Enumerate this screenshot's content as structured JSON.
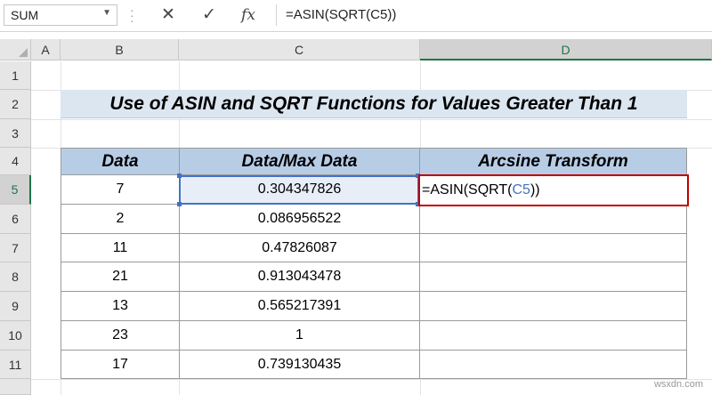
{
  "formula_bar": {
    "name_box": "SUM",
    "cancel_icon": "✕",
    "enter_icon": "✓",
    "fx_label": "fx",
    "formula": "=ASIN(SQRT(C5))"
  },
  "columns": [
    "A",
    "B",
    "C",
    "D"
  ],
  "rows": [
    "1",
    "2",
    "3",
    "4",
    "5",
    "6",
    "7",
    "8",
    "9",
    "10",
    "11"
  ],
  "title": "Use of ASIN and SQRT Functions for Values Greater Than 1",
  "table": {
    "headers": [
      "Data",
      "Data/Max Data",
      "Arcsine Transform"
    ],
    "data": [
      [
        "7",
        "0.304347826"
      ],
      [
        "2",
        "0.086956522"
      ],
      [
        "11",
        "0.47826087"
      ],
      [
        "21",
        "0.913043478"
      ],
      [
        "13",
        "0.565217391"
      ],
      [
        "23",
        "1"
      ],
      [
        "17",
        "0.739130435"
      ]
    ]
  },
  "editing_cell": {
    "prefix": "=ASIN(SQRT(",
    "ref": "C5",
    "suffix": "))"
  },
  "watermark": "wsxdn.com",
  "colors": {
    "accent": "#217346",
    "header_fill": "#b7cde6",
    "title_fill": "#dce6f1",
    "edit_border": "#c00000",
    "ref_blue": "#4472c4"
  }
}
